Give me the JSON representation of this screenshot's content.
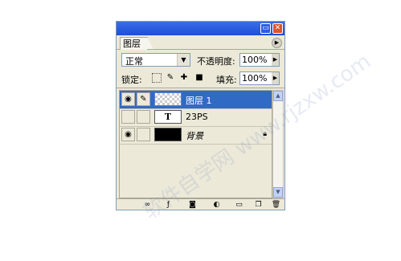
{
  "panel": {
    "tab_label": "图层",
    "blend_mode": "正常",
    "opacity_label": "不透明度:",
    "opacity_value": "100%",
    "lock_label": "锁定:",
    "fill_label": "填充:",
    "fill_value": "100%"
  },
  "layers": [
    {
      "name": "图层 1",
      "thumb": "transparent",
      "visible": true,
      "selected": true
    },
    {
      "name": "23PS",
      "thumb": "text",
      "thumb_text": "T",
      "visible": false,
      "selected": false
    },
    {
      "name": "背景",
      "thumb": "black",
      "visible": true,
      "selected": false,
      "locked": true
    }
  ],
  "icons": {
    "eye": "eye-icon",
    "brush": "brush-icon",
    "lock": "lock-icon",
    "text_thumb_letter": "T"
  },
  "watermark": "软件自学网 www.rjzxw.com",
  "colors": {
    "selection": "#316ac5",
    "panel_bg": "#ece9d8",
    "titlebar": "#1b4fd8"
  }
}
